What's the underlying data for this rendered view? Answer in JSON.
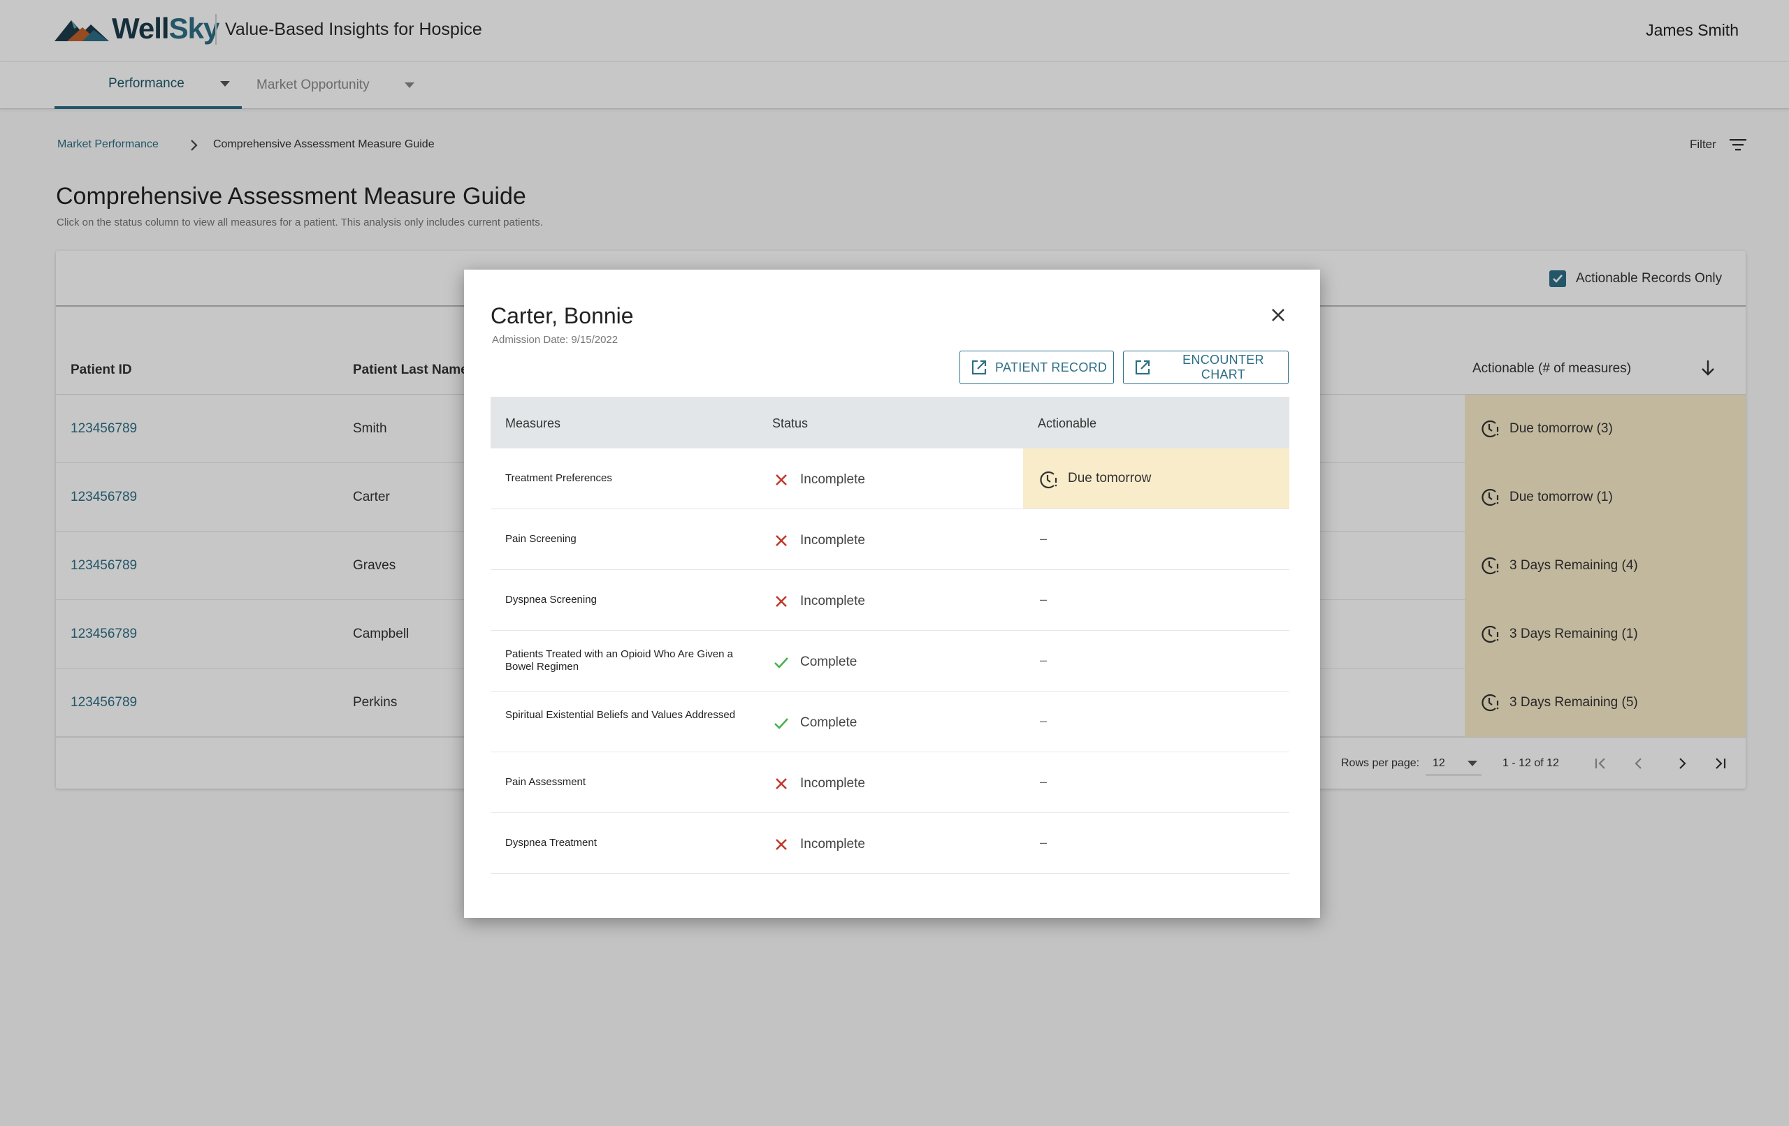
{
  "header": {
    "logo_text_well": "Well",
    "logo_text_sky": "Sky",
    "app_title": "Value-Based Insights for Hospice",
    "user_name": "James Smith"
  },
  "nav": {
    "tabs": [
      {
        "label": "Performance",
        "active": true
      },
      {
        "label": "Market Opportunity",
        "active": false
      }
    ]
  },
  "breadcrumb": {
    "parent": "Market Performance",
    "current": "Comprehensive Assessment Measure Guide"
  },
  "filter_label": "Filter",
  "page": {
    "title": "Comprehensive Assessment Measure Guide",
    "subtitle": "Click on the status column to view all measures for a patient.  This analysis only includes current patients."
  },
  "table": {
    "actionable_only_label": "Actionable Records Only",
    "actionable_only_checked": true,
    "columns": {
      "patient_id": "Patient ID",
      "patient_last_name": "Patient Last Name",
      "actionable": "Actionable (# of measures)"
    },
    "rows": [
      {
        "id": "123456789",
        "last": "Smith",
        "actionable": "Due tomorrow (3)"
      },
      {
        "id": "123456789",
        "last": "Carter",
        "actionable": "Due tomorrow (1)"
      },
      {
        "id": "123456789",
        "last": "Graves",
        "actionable": "3 Days Remaining (4)"
      },
      {
        "id": "123456789",
        "last": "Campbell",
        "actionable": "3 Days Remaining (1)"
      },
      {
        "id": "123456789",
        "last": "Perkins",
        "actionable": "3 Days Remaining (5)"
      }
    ],
    "pagination": {
      "rows_per_page_label": "Rows per page:",
      "rows_per_page": "12",
      "range": "1 - 12 of 12"
    }
  },
  "modal": {
    "patient_name": "Carter, Bonnie",
    "admission": "Admission Date: 9/15/2022",
    "patient_record_button": "PATIENT RECORD",
    "encounter_chart_button": "ENCOUNTER CHART",
    "columns": {
      "measures": "Measures",
      "status": "Status",
      "actionable": "Actionable"
    },
    "rows": [
      {
        "measure": "Treatment Preferences",
        "status": "Incomplete",
        "actionable": "Due tomorrow"
      },
      {
        "measure": "Pain Screening",
        "status": "Incomplete",
        "actionable": "–"
      },
      {
        "measure": "Dyspnea Screening",
        "status": "Incomplete",
        "actionable": "–"
      },
      {
        "measure": "Patients Treated with an Opioid Who Are Given a Bowel Regimen",
        "status": "Complete",
        "actionable": "–"
      },
      {
        "measure": "Spiritual Existential Beliefs and Values Addressed",
        "status": "Complete",
        "actionable": "–"
      },
      {
        "measure": "Pain Assessment",
        "status": "Incomplete",
        "actionable": "–"
      },
      {
        "measure": "Dyspnea Treatment",
        "status": "Incomplete",
        "actionable": "–"
      }
    ]
  },
  "colors": {
    "accent": "#2d6f86",
    "actionable_highlight": "#f9eccb",
    "incomplete": "#c0392b",
    "complete": "#4caf50"
  },
  "icons": {
    "close": "close-icon",
    "external": "external-link-icon",
    "clock": "clock-alert-icon",
    "sort": "arrow-down-icon",
    "filter": "filter-icon"
  }
}
